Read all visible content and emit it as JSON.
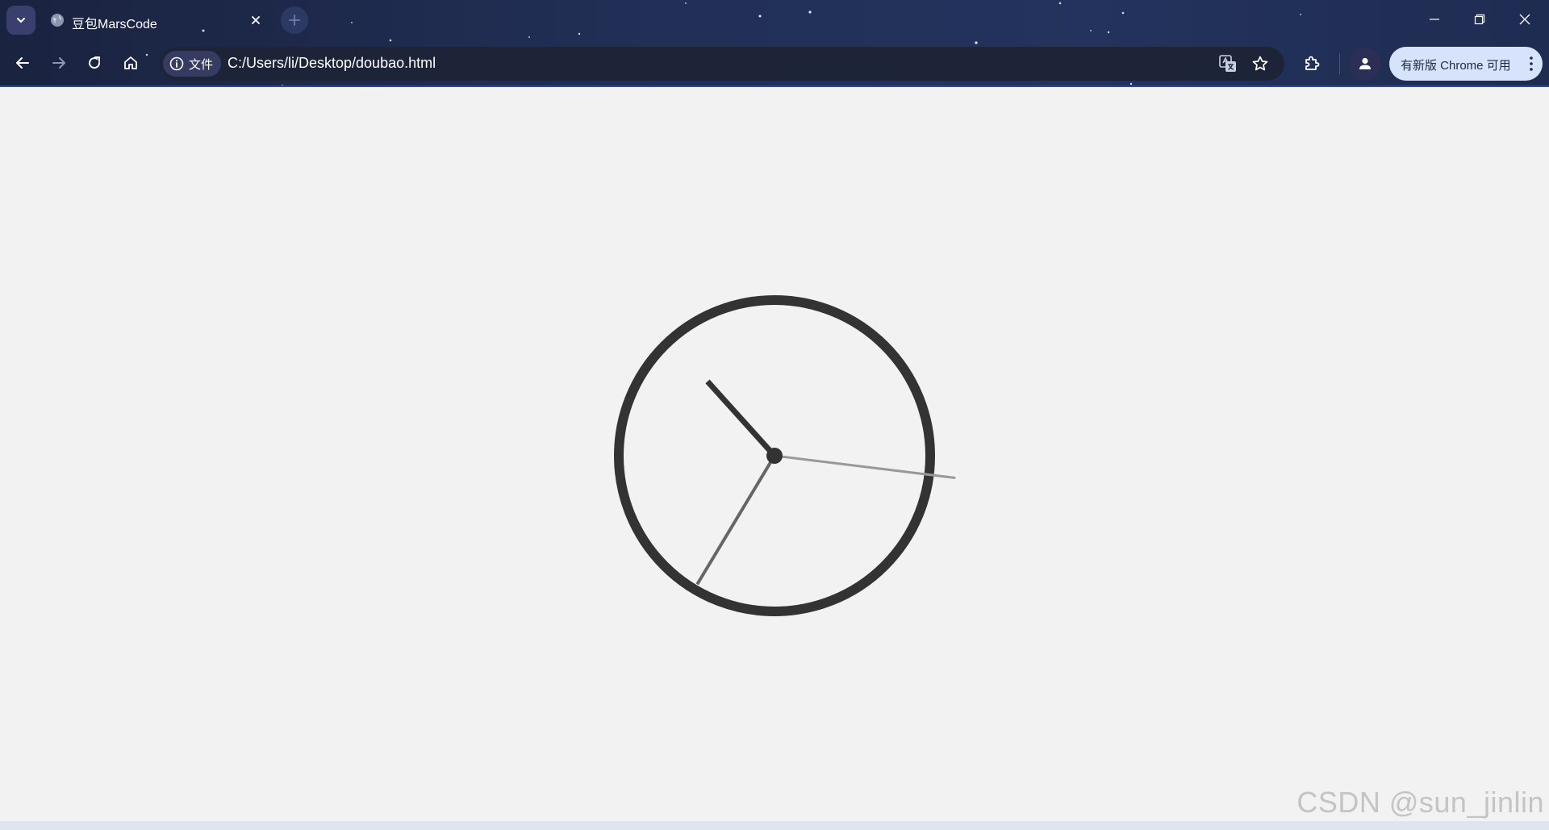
{
  "browser": {
    "tab": {
      "title": "豆包MarsCode"
    },
    "address_bar": {
      "site_chip_label": "文件",
      "url": "C:/Users/li/Desktop/doubao.html"
    },
    "update_button_label": "有新版 Chrome 可用"
  },
  "clock": {
    "hour_angle_deg": -42,
    "minute_angle_deg": 211,
    "second_angle_deg": 97
  },
  "watermark": "CSDN @sun_jinlin",
  "colors": {
    "chrome_bg": "#1f2c52",
    "page_bg": "#f2f2f2",
    "clock_face": "#333333",
    "minute_hand": "#666666",
    "second_hand": "#999999"
  },
  "icons": {
    "tab_search": "chevron-down-icon",
    "favicon": "globe-icon",
    "tab_close": "close-icon",
    "new_tab": "plus-icon",
    "back": "arrow-left-icon",
    "forward": "arrow-right-icon",
    "reload": "reload-icon",
    "home": "home-icon",
    "site_info": "info-icon",
    "translate": "translate-icon",
    "bookmark": "star-icon",
    "extensions": "puzzle-icon",
    "profile": "person-icon",
    "menu": "kebab-menu-icon"
  }
}
